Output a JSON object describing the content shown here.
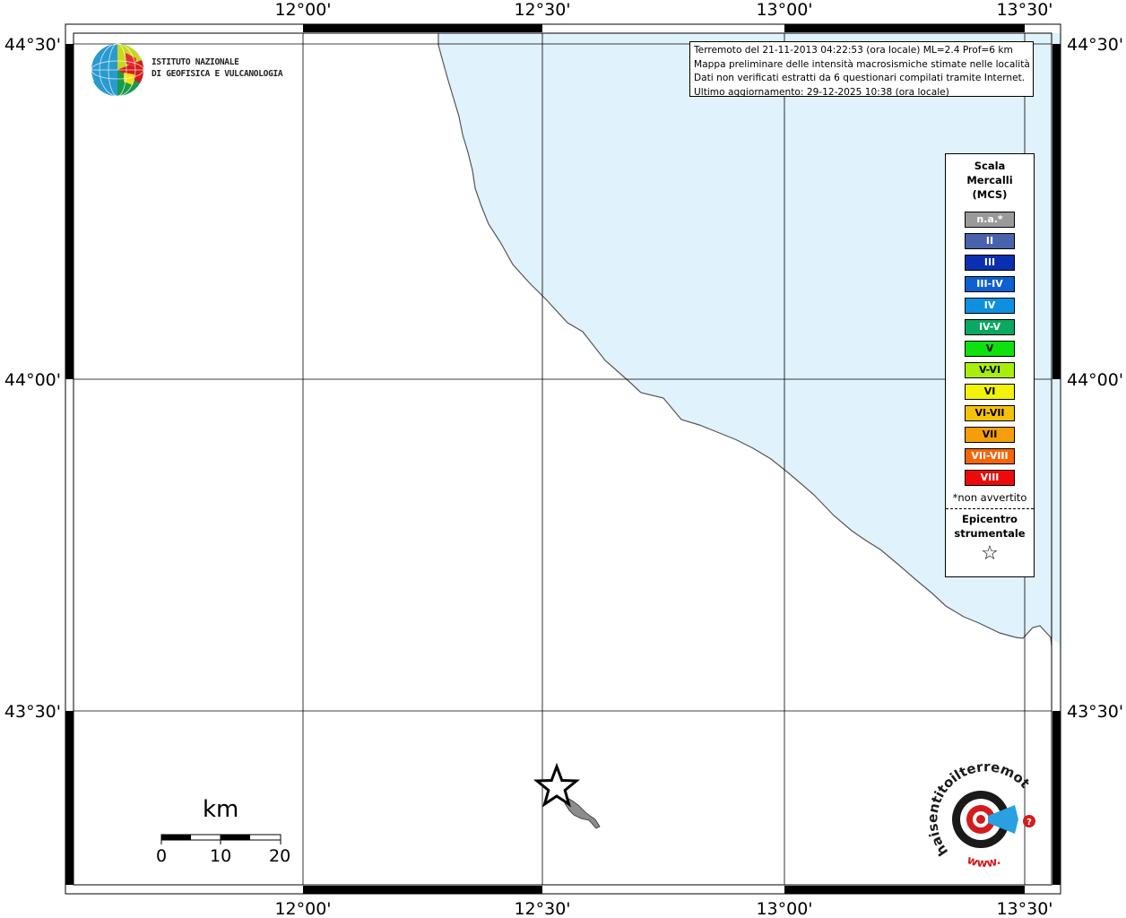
{
  "map": {
    "top_lon_labels": [
      "12°00'",
      "12°30'",
      "13°00'",
      "13°30'"
    ],
    "bottom_lon_labels": [
      "12°00'",
      "12°30'",
      "13°00'",
      "13°30'"
    ],
    "left_lat_labels": [
      "44°30'",
      "44°00'",
      "43°30'"
    ],
    "right_lat_labels": [
      "44°30'",
      "44°00'",
      "43°30'"
    ],
    "sea_color": "#e0f2fc",
    "land_color": "#ffffff"
  },
  "info": {
    "line1": "Terremoto del 21-11-2013 04:22:53 (ora locale) ML=2.4 Prof=6 km",
    "line2": "Mappa preliminare delle intensità macrosismiche stimate nelle località",
    "line3": "Dati non verificati estratti da 6 questionari compilati tramite Internet.",
    "line4": "Ultimo aggiornamento: 29-12-2025 10:38 (ora locale)"
  },
  "logo": {
    "line1": "ISTITUTO NAZIONALE",
    "line2": "DI GEOFISICA E VULCANOLOGIA"
  },
  "legend": {
    "title1": "Scala",
    "title2": "Mercalli",
    "title3": "(MCS)",
    "items": [
      {
        "label": "n.a.*",
        "color": "#9a9a9a"
      },
      {
        "label": "II",
        "color": "#4a62ac"
      },
      {
        "label": "III",
        "color": "#0a2fb0"
      },
      {
        "label": "III-IV",
        "color": "#0e5fd0"
      },
      {
        "label": "IV",
        "color": "#0e90e0"
      },
      {
        "label": "IV-V",
        "color": "#0aa860"
      },
      {
        "label": "V",
        "color": "#0ee20e"
      },
      {
        "label": "V-VI",
        "color": "#a8ee0a"
      },
      {
        "label": "VI",
        "color": "#f2f20a"
      },
      {
        "label": "VI-VII",
        "color": "#f5c20a"
      },
      {
        "label": "VII",
        "color": "#f59e0a"
      },
      {
        "label": "VII-VIII",
        "color": "#f5650a"
      },
      {
        "label": "VIII",
        "color": "#ee0a0a"
      }
    ],
    "note": "*non avvertito",
    "epicenter1": "Epicentro",
    "epicenter2": "strumentale",
    "star": "☆"
  },
  "scale": {
    "unit": "km",
    "labels": [
      "0",
      "10",
      "20"
    ]
  },
  "brand": {
    "text": "haisentitoilterremoto.it",
    "www": "www."
  }
}
